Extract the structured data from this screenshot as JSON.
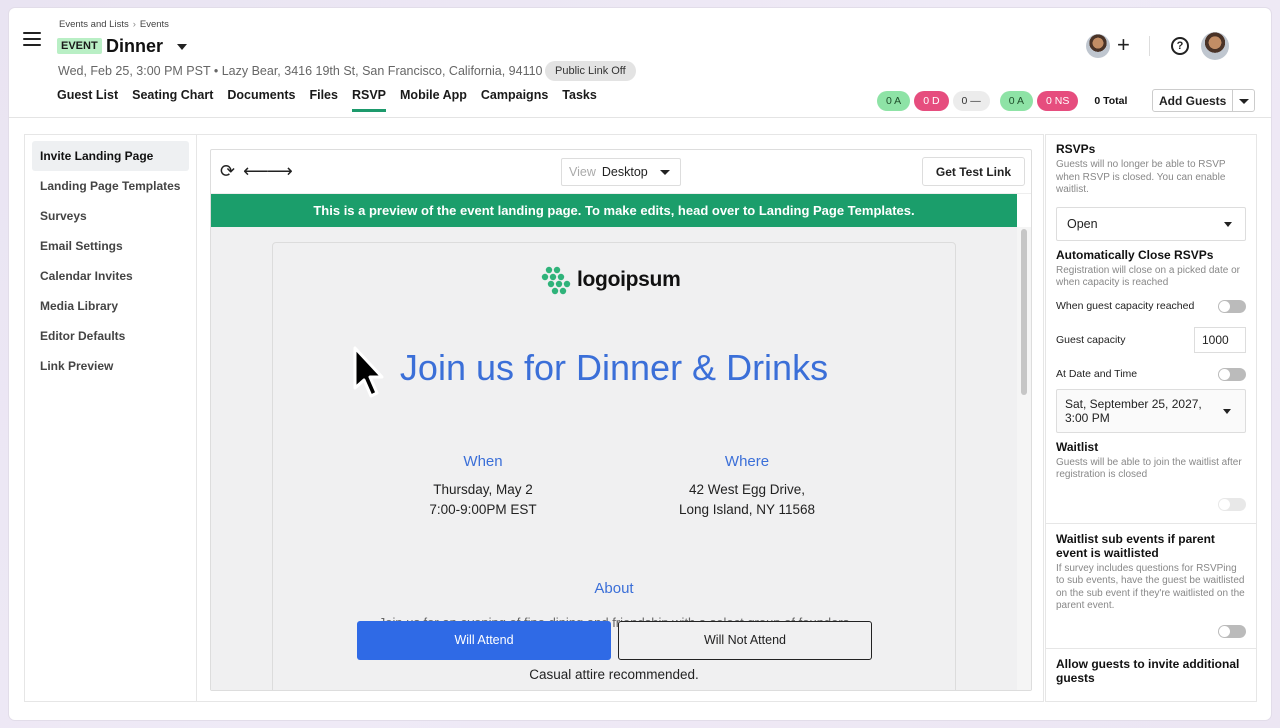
{
  "breadcrumb": {
    "part1": "Events and Lists",
    "separator": "›",
    "part2": "Events"
  },
  "event": {
    "badge": "EVENT",
    "title": "Dinner",
    "meta": "Wed, Feb 25, 3:00 PM PST • Lazy Bear, 3416 19th St, San Francisco, California, 94110",
    "public_link": "Public Link Off"
  },
  "tabs": [
    {
      "label": "Guest List"
    },
    {
      "label": "Seating Chart"
    },
    {
      "label": "Documents"
    },
    {
      "label": "Files"
    },
    {
      "label": "RSVP",
      "active": true
    },
    {
      "label": "Mobile App"
    },
    {
      "label": "Campaigns"
    },
    {
      "label": "Tasks"
    }
  ],
  "header_right": {
    "plus": "+",
    "help": "?",
    "pills": [
      "0 A",
      "0 D",
      "0 —",
      "0 A",
      "0 NS"
    ],
    "total": "0 Total",
    "add_guests": "Add Guests"
  },
  "sidebar": {
    "items": [
      {
        "label": "Invite Landing Page",
        "active": true
      },
      {
        "label": "Landing Page Templates"
      },
      {
        "label": "Surveys"
      },
      {
        "label": "Email Settings"
      },
      {
        "label": "Calendar Invites"
      },
      {
        "label": "Media Library"
      },
      {
        "label": "Editor Defaults"
      },
      {
        "label": "Link Preview"
      }
    ]
  },
  "preview": {
    "refresh_icon": "⟳",
    "back_icon": "⟵",
    "forward_icon": "⟶",
    "view_label": "View",
    "view_value": "Desktop",
    "test_link": "Get Test Link",
    "banner": "This is a preview of the event landing page. To make edits, head over to Landing Page Templates.",
    "logo_text": "logoipsum",
    "headline": "Join us for Dinner & Drinks",
    "when_title": "When",
    "when_line1": "Thursday, May 2",
    "when_line2": "7:00-9:00PM EST",
    "where_title": "Where",
    "where_line1": "42 West Egg Drive,",
    "where_line2": "Long Island, NY 11568",
    "about_title": "About",
    "about_text": "Join us for an evening of fine dining and friendship with a select group of founders",
    "attend": "Will Attend",
    "not_attend": "Will Not Attend",
    "attire": "Casual attire recommended."
  },
  "rsvp_panel": {
    "rsvps_title": "RSVPs",
    "rsvps_desc": "Guests will no longer be able to RSVP when RSVP is closed. You can enable waitlist.",
    "status_value": "Open",
    "auto_close_title": "Automatically Close RSVPs",
    "auto_close_desc": "Registration will close on a picked date or when capacity is reached",
    "capacity_toggle_label": "When guest capacity reached",
    "capacity_label": "Guest capacity",
    "capacity_value": "1000",
    "date_toggle_label": "At Date and Time",
    "date_line1": "Sat, September 25, 2027,",
    "date_line2": "3:00 PM",
    "waitlist_title": "Waitlist",
    "waitlist_desc": "Guests will be able to join the waitlist after registration is closed",
    "sub_events_title": "Waitlist sub events if parent event is waitlisted",
    "sub_events_desc": "If survey includes questions for RSVPing to sub events, have the guest be waitlisted on the sub event if they're waitlisted on the parent event.",
    "invite_title": "Allow guests to invite additional guests"
  },
  "colors": {
    "brand_green": "#1b9e6b",
    "accent_blue": "#2f6ae6",
    "headline_blue": "#3b6fd8",
    "pill_green": "#8ee3a6",
    "pill_red": "#e64d7e"
  }
}
